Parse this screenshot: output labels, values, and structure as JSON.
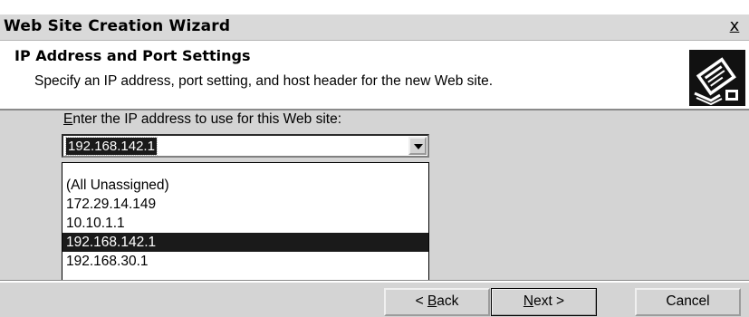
{
  "window": {
    "title": "Web Site Creation Wizard",
    "close_label": "x"
  },
  "header": {
    "title": "IP Address and Port Settings",
    "subtitle": "Specify an IP address, port setting, and host header for the new Web site.",
    "logo_icon": "wizard-book-icon"
  },
  "ip_field": {
    "label_mnemonic": "E",
    "label_rest": "nter the IP address to use for this Web site:",
    "selected_value": "192.168.142.1",
    "options": [
      "(All Unassigned)",
      "172.29.14.149",
      "10.10.1.1",
      "192.168.142.1",
      "192.168.30.1"
    ],
    "selected_index": 3
  },
  "buttons": {
    "back_prefix": "< ",
    "back_mnemonic": "B",
    "back_rest": "ack",
    "next_mnemonic": "N",
    "next_rest": "ext >",
    "cancel": "Cancel"
  },
  "colors": {
    "dialog_face": "#d4d4d4",
    "selection": "#1a1a1a"
  }
}
